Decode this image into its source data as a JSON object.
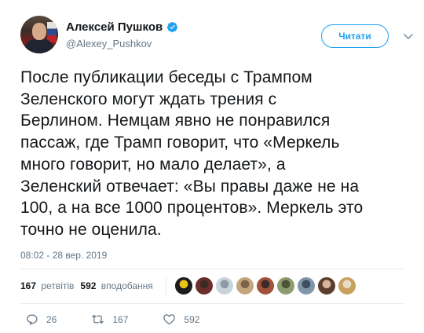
{
  "author": {
    "display_name": "Алексей Пушков",
    "handle": "@Alexey_Pushkov",
    "verified": true
  },
  "follow_button_label": "Читати",
  "tweet": {
    "lines": [
      "После публикации беседы с Трампом",
      "Зеленского могут ждать трения с",
      "Берлином. Немцам явно не понравился",
      "пассаж, где Трамп говорит, что «Меркель",
      "много говорит, но мало делает», а",
      "Зеленский отвечает: «Вы правы даже не на",
      "100, а на все 1000 процентов». Меркель это",
      "точно не оценила."
    ],
    "timestamp": "08:02 - 28 вер. 2019"
  },
  "stats": {
    "retweets_count": "167",
    "retweets_label": "ретвітів",
    "likes_count": "592",
    "likes_label": "вподобання"
  },
  "actions": {
    "reply_count": "26",
    "retweet_count": "167",
    "like_count": "592"
  },
  "colors": {
    "accent": "#1da1f2",
    "secondary_text": "#657786",
    "primary_text": "#14171a",
    "divider": "#e6ecf0"
  },
  "liker_avatar_colors": [
    [
      "#1b1b1b",
      "#e9c21a"
    ],
    [
      "#6b2e2a",
      "#3d2a24"
    ],
    [
      "#c9d3db",
      "#8a9aa8"
    ],
    [
      "#c4a57e",
      "#7f6247"
    ],
    [
      "#a0523c",
      "#3b2a25"
    ],
    [
      "#8e9a6f",
      "#4a5436"
    ],
    [
      "#7f96a8",
      "#3c4f60"
    ],
    [
      "#5b3d2e",
      "#d3b59a"
    ],
    [
      "#c9a15f",
      "#e8dcc8"
    ]
  ]
}
